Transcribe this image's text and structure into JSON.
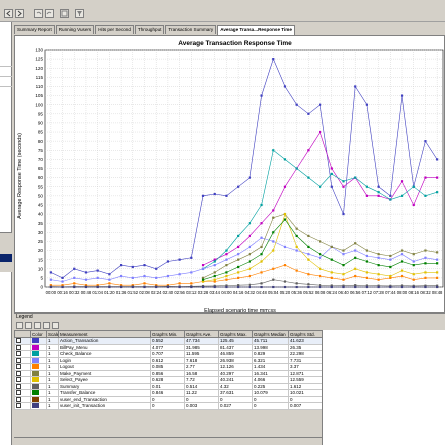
{
  "tabs": [
    {
      "label": "Summary Report"
    },
    {
      "label": "Running Vusers"
    },
    {
      "label": "Hits per Second"
    },
    {
      "label": "Throughput"
    },
    {
      "label": "Transaction Summary"
    },
    {
      "label": "Average Transa...Response Time"
    }
  ],
  "legend": {
    "title": "Legend",
    "columns": [
      "Color",
      "Scale",
      "Measurement",
      "Graph's Min.",
      "Graph's Ave.",
      "Graph's Max.",
      "Graph's Median",
      "Graph's Std."
    ],
    "rows": [
      {
        "color": "#4040c0",
        "scale": "1",
        "name": "Action_Transaction",
        "min": "0.552",
        "ave": "47.734",
        "max": "125.45",
        "median": "45.711",
        "std": "41.623"
      },
      {
        "color": "#c000c0",
        "scale": "1",
        "name": "BillPay_Menu",
        "min": "4.077",
        "ave": "31.985",
        "max": "81.437",
        "median": "13.998",
        "std": "26.35"
      },
      {
        "color": "#00a0a0",
        "scale": "1",
        "name": "Check_Balance",
        "min": "0.707",
        "ave": "11.595",
        "max": "46.859",
        "median": "0.829",
        "std": "22.298"
      },
      {
        "color": "#8080ff",
        "scale": "1",
        "name": "Login",
        "min": "0.612",
        "ave": "7.618",
        "max": "26.938",
        "median": "6.321",
        "std": "7.731"
      },
      {
        "color": "#ff8000",
        "scale": "1",
        "name": "Logout",
        "min": "0.085",
        "ave": "2.77",
        "max": "12.126",
        "median": "1.434",
        "std": "3.37"
      },
      {
        "color": "#808040",
        "scale": "1",
        "name": "Make_Payment",
        "min": "0.856",
        "ave": "16.58",
        "max": "40.297",
        "median": "16.341",
        "std": "12.871"
      },
      {
        "color": "#e0c000",
        "scale": "1",
        "name": "Select_Payee",
        "min": "0.628",
        "ave": "7.72",
        "max": "40.241",
        "median": "4.066",
        "std": "12.559"
      },
      {
        "color": "#606060",
        "scale": "1",
        "name": "Summary",
        "min": "0.01",
        "ave": "0.514",
        "max": "4.32",
        "median": "0.225",
        "std": "1.612"
      },
      {
        "color": "#008000",
        "scale": "1",
        "name": "Transfer_Balance",
        "min": "0.846",
        "ave": "11.22",
        "max": "37.631",
        "median": "10.079",
        "std": "10.021"
      },
      {
        "color": "#804000",
        "scale": "1",
        "name": "vuser_end_Transaction",
        "min": "0",
        "ave": "0",
        "max": "0",
        "median": "0",
        "std": "0"
      },
      {
        "color": "#404080",
        "scale": "1",
        "name": "vuser_init_Transaction",
        "min": "0",
        "ave": "0.003",
        "max": "0.027",
        "median": "0",
        "std": "0.007"
      }
    ]
  },
  "chart_data": {
    "type": "line",
    "title": "Average Transaction Response Time",
    "xlabel": "Elapsed scenario time mm:ss",
    "ylabel": "Average Response Time (seconds)",
    "ylim": [
      0,
      130
    ],
    "yticks": [
      0,
      5,
      10,
      15,
      20,
      25,
      30,
      35,
      40,
      45,
      50,
      55,
      60,
      65,
      70,
      75,
      80,
      85,
      90,
      95,
      100,
      105,
      110,
      115,
      120,
      125,
      130
    ],
    "x": [
      "00:00",
      "00:16",
      "00:32",
      "00:48",
      "01:04",
      "01:20",
      "01:36",
      "01:52",
      "02:08",
      "02:24",
      "02:40",
      "02:56",
      "03:12",
      "03:28",
      "03:44",
      "04:00",
      "04:16",
      "04:32",
      "04:48",
      "05:04",
      "05:20",
      "05:36",
      "05:52",
      "06:08",
      "06:24",
      "06:40",
      "06:56",
      "07:12",
      "07:28",
      "07:44",
      "08:00",
      "08:16",
      "08:32",
      "08:48"
    ],
    "grid": true,
    "series": [
      {
        "color": "#4040c0",
        "values": [
          8,
          5,
          10,
          8,
          9,
          7,
          12,
          11,
          12,
          10,
          14,
          15,
          16,
          50,
          51,
          50,
          55,
          60,
          105,
          125,
          110,
          100,
          95,
          100,
          55,
          40,
          110,
          100,
          55,
          50,
          105,
          55,
          80,
          70
        ]
      },
      {
        "color": "#c000c0",
        "values": [
          null,
          null,
          null,
          null,
          null,
          null,
          null,
          null,
          null,
          null,
          null,
          null,
          null,
          12,
          15,
          18,
          22,
          28,
          35,
          42,
          55,
          65,
          75,
          85,
          65,
          55,
          60,
          50,
          50,
          48,
          58,
          45,
          60,
          60
        ]
      },
      {
        "color": "#00a0a0",
        "values": [
          null,
          null,
          null,
          null,
          null,
          null,
          null,
          null,
          null,
          null,
          null,
          null,
          null,
          10,
          14,
          20,
          28,
          35,
          45,
          75,
          70,
          65,
          60,
          55,
          62,
          58,
          60,
          55,
          52,
          48,
          50,
          55,
          50,
          52
        ]
      },
      {
        "color": "#8080ff",
        "values": [
          4,
          3,
          5,
          4,
          5,
          4,
          6,
          5,
          6,
          5,
          6,
          7,
          8,
          10,
          12,
          15,
          18,
          22,
          27,
          25,
          22,
          20,
          18,
          16,
          22,
          18,
          20,
          17,
          16,
          15,
          18,
          14,
          16,
          15
        ]
      },
      {
        "color": "#ff8000",
        "values": [
          1,
          1,
          2,
          1,
          1,
          2,
          1,
          1,
          2,
          1,
          1,
          2,
          2,
          3,
          3,
          4,
          5,
          6,
          8,
          10,
          12,
          9,
          7,
          6,
          5,
          4,
          6,
          5,
          4,
          5,
          6,
          4,
          5,
          5
        ]
      },
      {
        "color": "#808040",
        "values": [
          null,
          null,
          null,
          null,
          null,
          null,
          null,
          null,
          null,
          null,
          null,
          null,
          null,
          5,
          8,
          12,
          15,
          18,
          22,
          38,
          40,
          32,
          28,
          25,
          22,
          20,
          24,
          20,
          18,
          17,
          20,
          18,
          20,
          19
        ]
      },
      {
        "color": "#e0c000",
        "values": [
          null,
          null,
          null,
          null,
          null,
          null,
          null,
          null,
          null,
          null,
          null,
          null,
          null,
          3,
          4,
          6,
          8,
          10,
          14,
          20,
          40,
          22,
          15,
          10,
          8,
          7,
          10,
          8,
          7,
          6,
          9,
          7,
          8,
          8
        ]
      },
      {
        "color": "#606060",
        "values": [
          0.2,
          0.1,
          0.3,
          0.2,
          0.2,
          0.3,
          0.2,
          0.3,
          0.2,
          0.3,
          0.4,
          0.3,
          0.4,
          0.5,
          0.6,
          0.8,
          1,
          1.2,
          2,
          4,
          3,
          2,
          1.5,
          1,
          0.8,
          0.7,
          1,
          0.8,
          0.7,
          0.6,
          0.8,
          0.6,
          0.7,
          0.7
        ]
      },
      {
        "color": "#008000",
        "values": [
          null,
          null,
          null,
          null,
          null,
          null,
          null,
          null,
          null,
          null,
          null,
          null,
          null,
          4,
          6,
          8,
          11,
          14,
          18,
          30,
          37,
          28,
          22,
          18,
          15,
          12,
          16,
          14,
          12,
          11,
          14,
          12,
          13,
          13
        ]
      },
      {
        "color": "#404080",
        "values": [
          0,
          0,
          0,
          0,
          0,
          0,
          0,
          0,
          0,
          0,
          0,
          0,
          0,
          0,
          0,
          0,
          0,
          0,
          0,
          0,
          0,
          0,
          0,
          0,
          0,
          0,
          0,
          0,
          0,
          0,
          0,
          0,
          0,
          0
        ]
      }
    ]
  }
}
